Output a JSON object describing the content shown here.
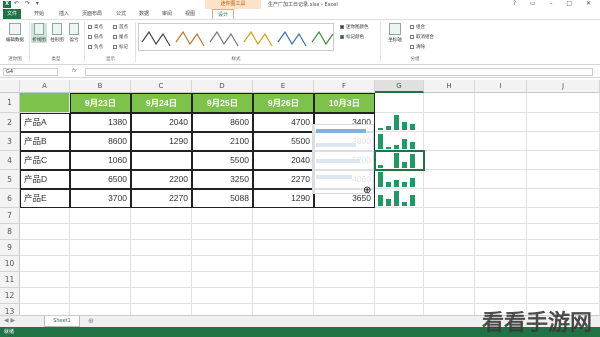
{
  "titlebar": {
    "app_icon": "X",
    "qat": "↶ ↷ ▾",
    "tool_context": "迷你图工具",
    "doc_title": "生产厂加工日记录.xlsx - Excel",
    "controls": "? ▭ – □ ✕"
  },
  "tabs": [
    "文件",
    "开始",
    "插入",
    "页面布局",
    "公式",
    "数据",
    "审阅",
    "视图",
    "设计"
  ],
  "ribbon": {
    "sparkline_group": "迷你图",
    "edit_data": "编辑数据",
    "type_group": "类型",
    "types": [
      "折线图",
      "柱形图",
      "盈亏"
    ],
    "show_group": "显示",
    "show_options": [
      "高点",
      "低点",
      "负点",
      "首点",
      "尾点",
      "标记"
    ],
    "style_group": "样式",
    "sparkline_color": "迷你图颜色",
    "marker_color": "标记颜色",
    "axis": "坐标轴",
    "group_btn": "组合",
    "ungroup_btn": "取消组合",
    "clear_btn": "清除",
    "grouping_group": "分组"
  },
  "formula_bar": {
    "name_box": "G4",
    "fx": "fx",
    "value": ""
  },
  "columns": [
    "A",
    "B",
    "C",
    "D",
    "E",
    "F",
    "G",
    "H",
    "I",
    "J"
  ],
  "rows": [
    "1",
    "2",
    "3",
    "4",
    "5",
    "6",
    "7",
    "8",
    "9",
    "10",
    "11",
    "12",
    "13"
  ],
  "table": {
    "headers": [
      "9月23日",
      "9月24日",
      "9月25日",
      "9月26日",
      "10月3日"
    ],
    "rows": [
      {
        "name": "产品A",
        "values": [
          "1380",
          "2040",
          "8600",
          "4700",
          "3400"
        ]
      },
      {
        "name": "产品B",
        "values": [
          "8600",
          "1290",
          "2100",
          "5500",
          "3800"
        ]
      },
      {
        "name": "产品C",
        "values": [
          "1060",
          "",
          "5500",
          "2040",
          "5200"
        ]
      },
      {
        "name": "产品D",
        "values": [
          "6500",
          "2200",
          "3250",
          "2270",
          "4060"
        ]
      },
      {
        "name": "产品E",
        "values": [
          "3700",
          "2270",
          "5088",
          "1290",
          "3650"
        ]
      }
    ]
  },
  "sheet_tab": "Sheet1",
  "status": "就绪",
  "watermark": "看看手游网",
  "colors": {
    "accent": "#217346",
    "header_fill": "#7dc24b",
    "sparkline": "#1e9b65",
    "context_tab": "#fbe3c9"
  }
}
